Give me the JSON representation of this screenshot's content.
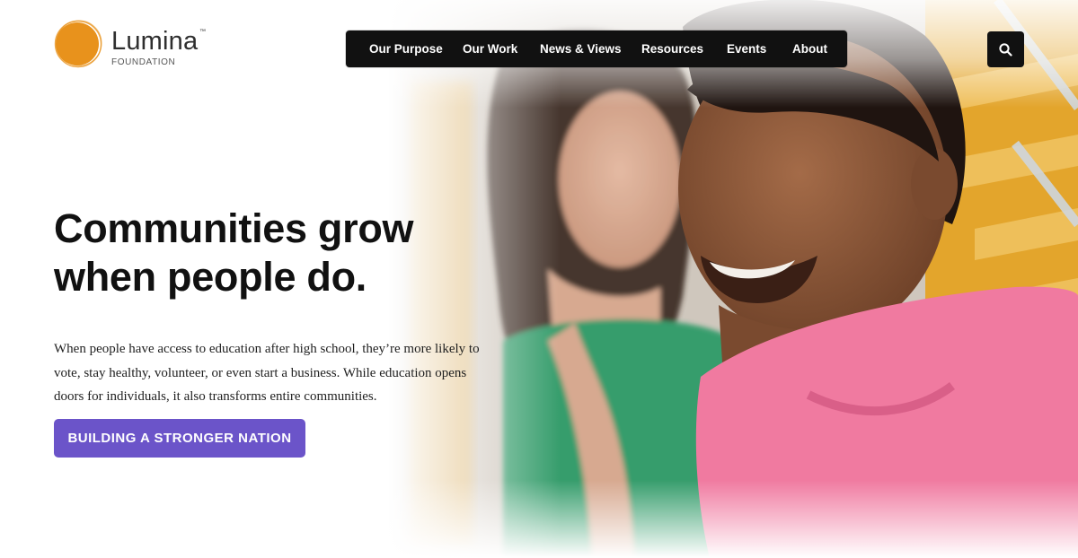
{
  "brand": {
    "name": "Lumina",
    "tm": "™",
    "subtitle": "FOUNDATION",
    "colors": {
      "logo_orange": "#e8921c",
      "accent_purple": "#6b54c9",
      "nav_bg": "#111111"
    }
  },
  "nav": {
    "items": [
      {
        "label": "Our Purpose"
      },
      {
        "label": "Our Work"
      },
      {
        "label": "News & Views"
      },
      {
        "label": "Resources"
      },
      {
        "label": "Events"
      },
      {
        "label": "About"
      }
    ],
    "search_icon": "search-icon"
  },
  "hero": {
    "headline_line1": "Communities grow",
    "headline_line2": "when people do.",
    "body_lines": [
      "When people have access to education after high school, they’re more likely to",
      "vote, stay healthy, volunteer, or even start a business. While education opens",
      "doors for individuals, it also transforms entire communities."
    ],
    "cta_label": "BUILDING A STRONGER NATION"
  }
}
